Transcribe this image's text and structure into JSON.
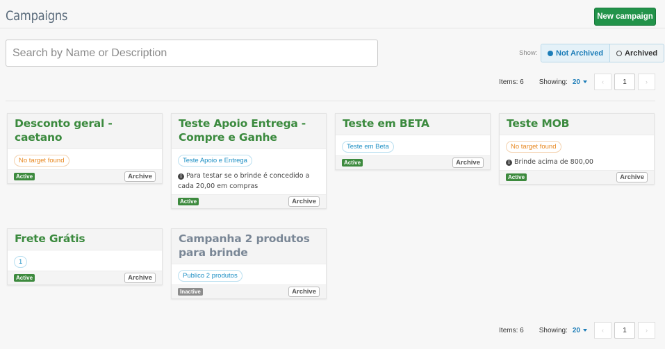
{
  "header": {
    "title": "Campaigns",
    "new_campaign_label": "New campaign"
  },
  "search": {
    "placeholder": "Search by Name or Description",
    "value": ""
  },
  "filter": {
    "show_label": "Show:",
    "options": [
      "Not Archived",
      "Archived"
    ],
    "selected": "Not Archived"
  },
  "pagination": {
    "items_text": "Items: 6",
    "showing_label": "Showing:",
    "showing_value": "20",
    "page": "1",
    "prev_icon": "chevron-left-icon",
    "next_icon": "chevron-right-icon"
  },
  "colors": {
    "accent": "#22934a",
    "title_green": "#3b8a3e",
    "link_blue": "#1c7db8",
    "warning": "#e8871e",
    "inactive": "#8d8d8d"
  },
  "campaigns": [
    {
      "title": "Desconto geral - caetano",
      "tag": "No target found",
      "tag_type": "warning",
      "note": "",
      "status": "Active",
      "archive_label": "Archive"
    },
    {
      "title": "Teste Apoio Entrega - Compre e Ganhe",
      "tag": "Teste Apoio e Entrega",
      "tag_type": "info",
      "note": "Para testar se o brinde é concedido a cada 20,00 em compras",
      "status": "Active",
      "archive_label": "Archive"
    },
    {
      "title": "Teste em BETA",
      "tag": "Teste em Beta",
      "tag_type": "info",
      "note": "",
      "status": "Active",
      "archive_label": "Archive"
    },
    {
      "title": "Teste MOB",
      "tag": "No target found",
      "tag_type": "warning",
      "note": "Brinde acima de 800,00",
      "status": "Active",
      "archive_label": "Archive"
    },
    {
      "title": "Frete Grátis",
      "tag": "1",
      "tag_type": "info",
      "note": "",
      "status": "Active",
      "archive_label": "Archive"
    },
    {
      "title": "Campanha 2 produtos para brinde",
      "tag": "Publico 2 produtos",
      "tag_type": "info",
      "note": "",
      "status": "Inactive",
      "archive_label": "Archive"
    }
  ]
}
